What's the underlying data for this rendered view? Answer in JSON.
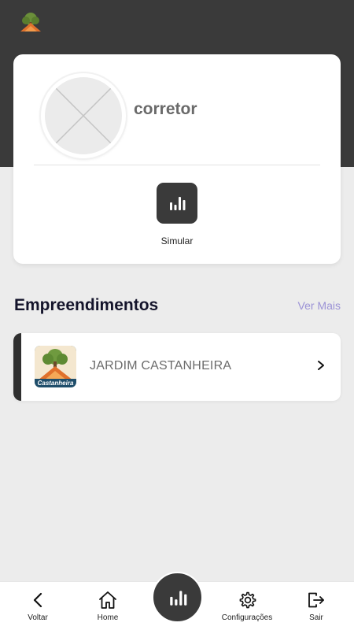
{
  "profile": {
    "name": "corretor",
    "action_label": "Simular"
  },
  "section": {
    "title": "Empreendimentos",
    "see_more": "Ver Mais"
  },
  "projects": [
    {
      "name": "JARDIM CASTANHEIRA",
      "logo_text": "Castanheira"
    }
  ],
  "nav": {
    "back": "Voltar",
    "home": "Home",
    "settings": "Configurações",
    "logout": "Sair"
  },
  "colors": {
    "dark": "#3a3a3a",
    "accent_link": "#9b92d6",
    "background": "#ececec"
  }
}
